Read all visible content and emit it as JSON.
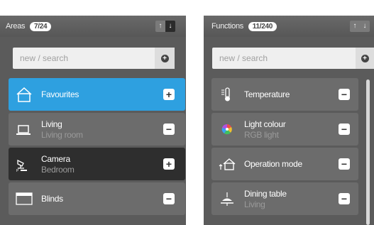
{
  "areas": {
    "title": "Areas",
    "count": "7/24",
    "sort_up": "↑",
    "sort_down": "↓",
    "search_placeholder": "new / search",
    "items": [
      {
        "label": "Favourites",
        "sub": "",
        "icon": "home-outline-icon",
        "action": "+"
      },
      {
        "label": "Living",
        "sub": "Living room",
        "icon": "laptop-icon",
        "action": "−"
      },
      {
        "label": "Camera",
        "sub": "Bedroom",
        "icon": "camera-icon",
        "action": "+"
      },
      {
        "label": "Blinds",
        "sub": "",
        "icon": "blinds-icon",
        "action": "−"
      }
    ]
  },
  "functions": {
    "title": "Functions",
    "count": "11/240",
    "sort_up": "↑",
    "sort_down": "↓",
    "search_placeholder": "new / search",
    "items": [
      {
        "label": "Temperature",
        "sub": "",
        "icon": "thermometer-icon",
        "action": "−"
      },
      {
        "label": "Light colour",
        "sub": "RGB light",
        "icon": "color-wheel-icon",
        "action": "−"
      },
      {
        "label": "Operation mode",
        "sub": "",
        "icon": "home-mode-icon",
        "action": "−"
      },
      {
        "label": "Dining table",
        "sub": "Living",
        "icon": "ceiling-lamp-icon",
        "action": "−"
      }
    ]
  },
  "colors": {
    "accent": "#2ea0e0",
    "panel": "#5b5b5b",
    "row": "#6c6c6c",
    "row_dark": "#2e2e2e"
  }
}
